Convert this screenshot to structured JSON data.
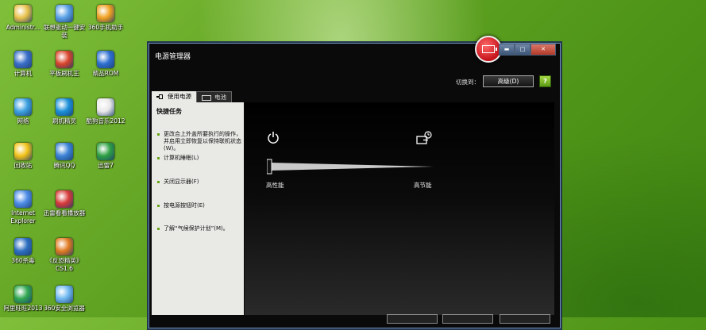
{
  "desktop": {
    "icons": [
      {
        "label": "Administr...",
        "icon": "user-folder-icon"
      },
      {
        "label": "联想驱动一键安装",
        "icon": "tools-icon"
      },
      {
        "label": "360手机助手",
        "icon": "phone-assistant-icon"
      },
      {
        "label": "计算机",
        "icon": "computer-icon"
      },
      {
        "label": "平板刷机王",
        "icon": "tablet-flash-icon"
      },
      {
        "label": "精品ROM",
        "icon": "rom-icon"
      },
      {
        "label": "网络",
        "icon": "network-icon"
      },
      {
        "label": "刷机精灵",
        "icon": "flash-genie-icon"
      },
      {
        "label": "酷狗音乐2012",
        "icon": "music-icon"
      },
      {
        "label": "回收站",
        "icon": "recycle-bin-icon"
      },
      {
        "label": "腾讯QQ",
        "icon": "qq-icon"
      },
      {
        "label": "迅雷7",
        "icon": "thunder-icon"
      },
      {
        "label": "Internet Explorer",
        "icon": "ie-icon"
      },
      {
        "label": "迅雷看看播放器",
        "icon": "player-icon"
      },
      {
        "label": "360杀毒",
        "icon": "antivirus-icon"
      },
      {
        "label": "《反恐精英》CS1.6",
        "icon": "cs-game-icon"
      },
      {
        "label": "阿里旺旺2013",
        "icon": "wangwang-icon"
      },
      {
        "label": "360安全浏览器",
        "icon": "browser-icon"
      }
    ]
  },
  "window": {
    "title": "电源管理器",
    "switch_label": "切换到：",
    "switch_value": "高级(D)",
    "help": "?",
    "tabs": [
      {
        "label": "使用电源"
      },
      {
        "label": "电池"
      }
    ],
    "quick_tasks": {
      "heading": "快捷任务",
      "items": [
        "更改合上外盖所要执行的操作，并启用立即恢复以保持联机状态(W)。",
        "计算机睡眠(L)",
        "关闭显示器(F)",
        "按电源按钮时(E)",
        "了解“气候保护计划”(M)。"
      ]
    },
    "slider": {
      "left_label": "高性能",
      "right_label": "高节能",
      "level_percent": 0
    }
  },
  "colors": {
    "accent_green": "#69a61c",
    "window_bg": "#0a0a0a",
    "badge_red": "#c5121a"
  }
}
